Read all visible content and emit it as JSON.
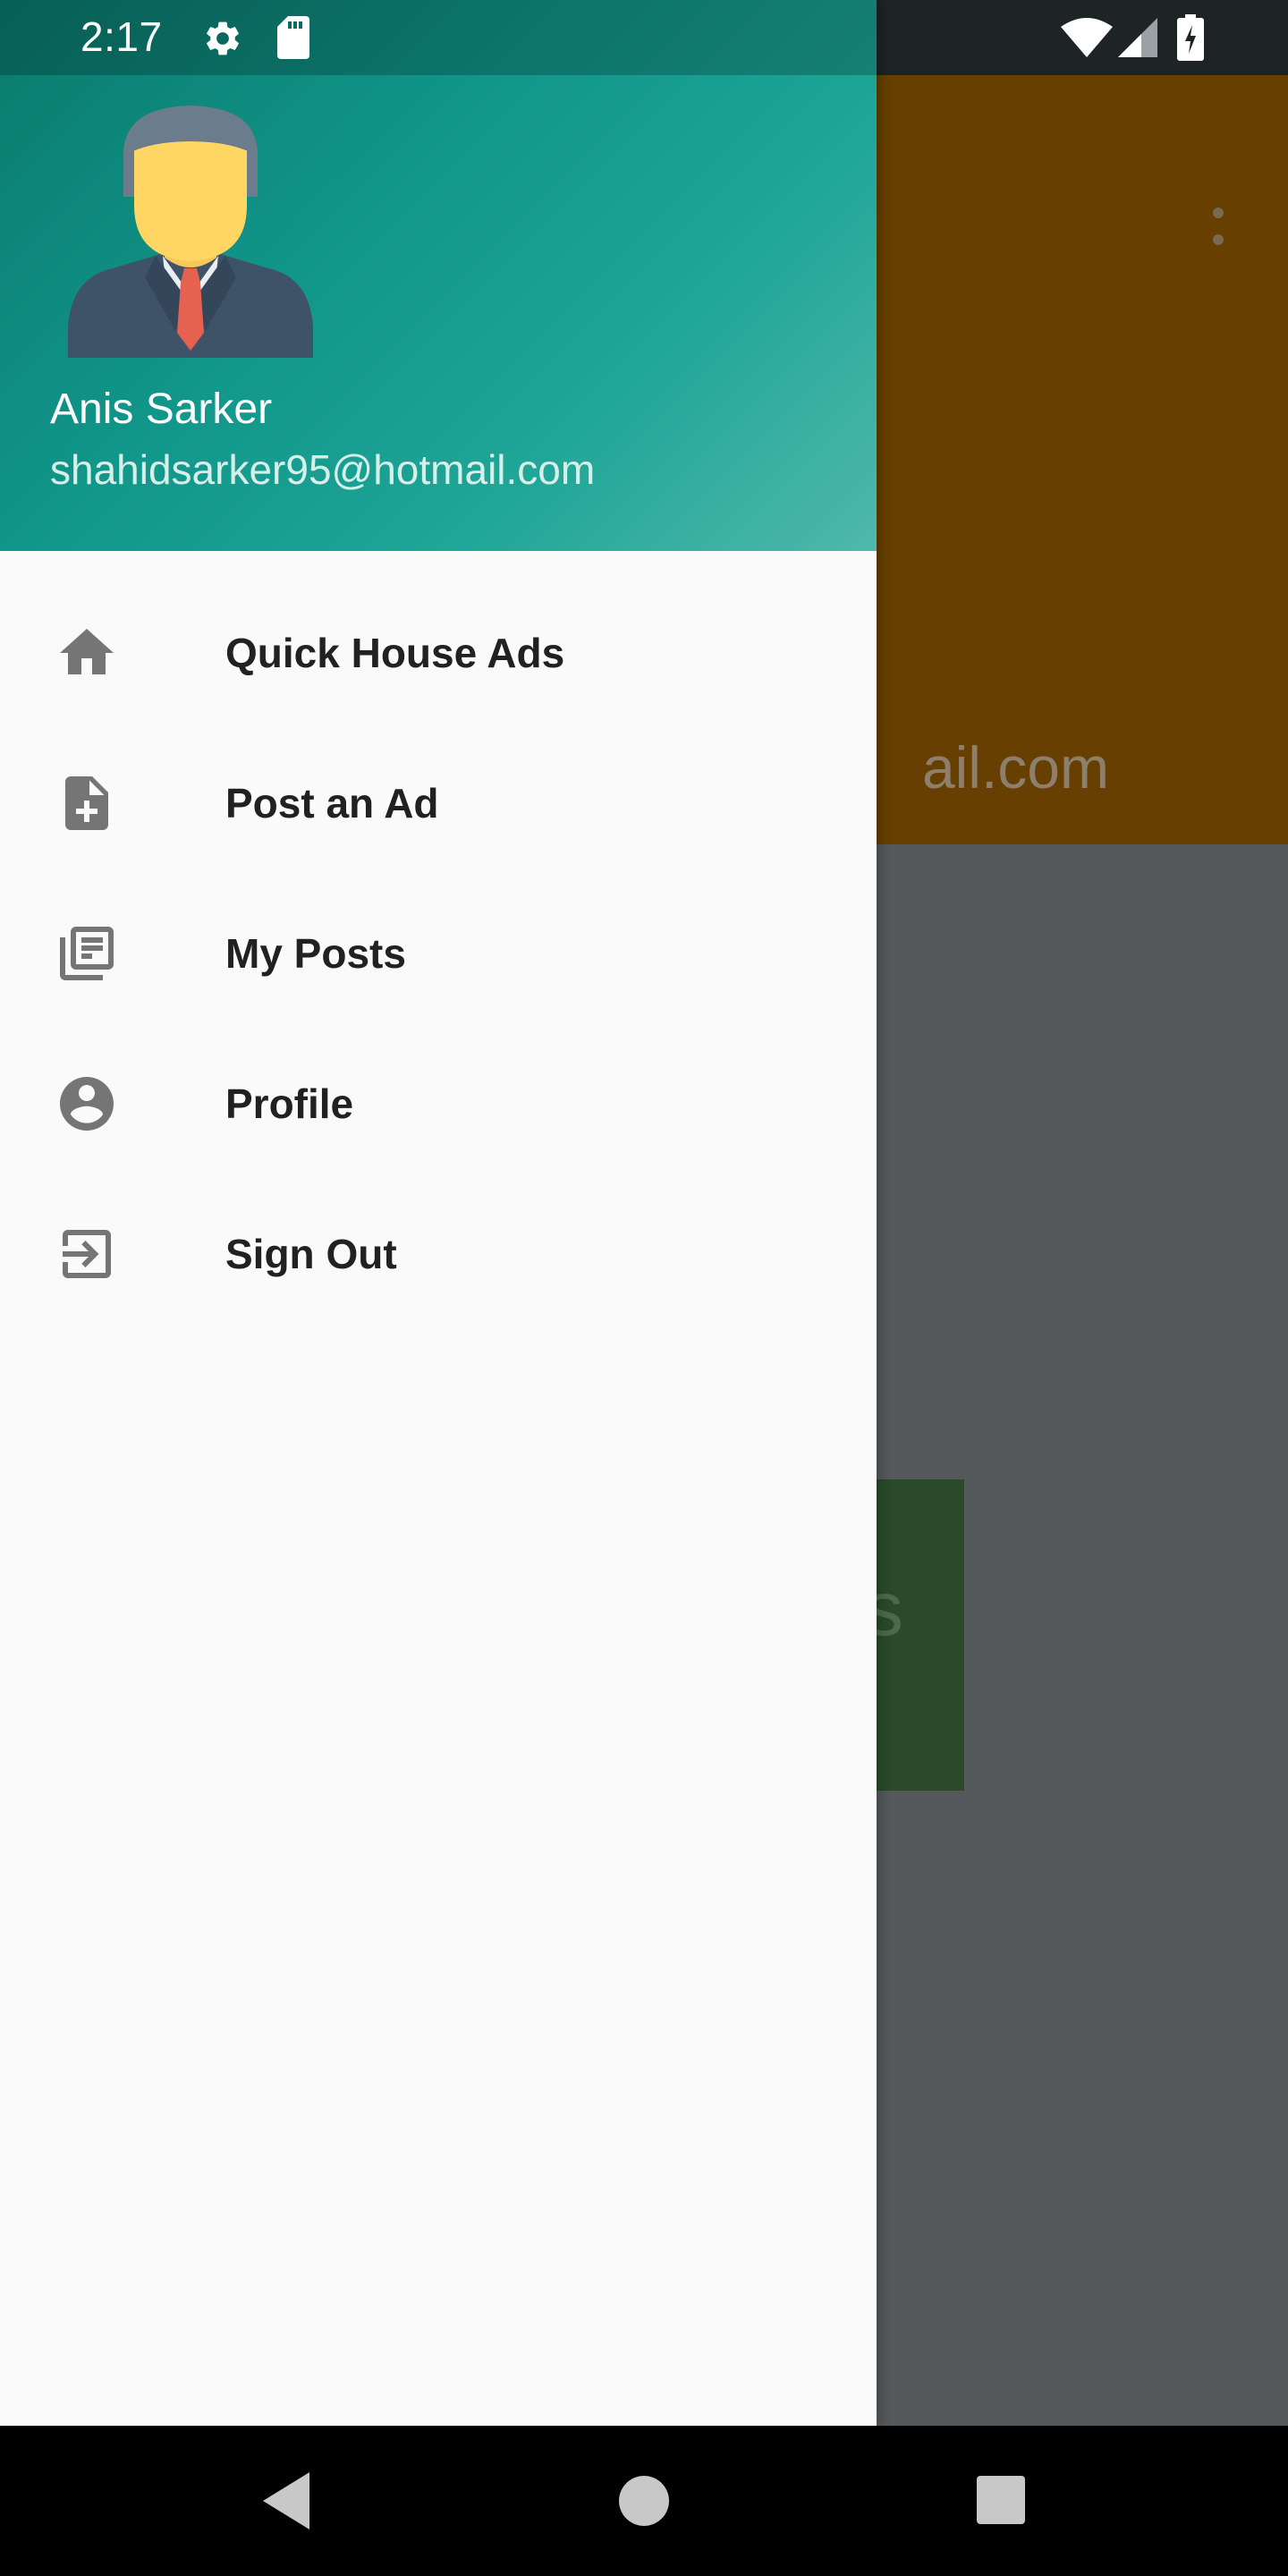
{
  "status_bar": {
    "time": "2:17",
    "icons": [
      "gear-icon",
      "sd-card-icon",
      "wifi-icon",
      "signal-icon",
      "battery-charging-icon"
    ]
  },
  "background": {
    "email_fragment": "ail.com",
    "button_fragment": "s",
    "toolbar_color": "#663f01",
    "button_color": "#2a4a29"
  },
  "drawer": {
    "header": {
      "name": "Anis Sarker",
      "email": "shahidsarker95@hotmail.com",
      "avatar_icon": "businessman-avatar-icon",
      "gradient_start": "#0a7a6d",
      "gradient_end": "#4fb8ac"
    },
    "items": [
      {
        "label": "Quick House Ads",
        "icon": "home-icon"
      },
      {
        "label": "Post an Ad",
        "icon": "note-add-icon"
      },
      {
        "label": "My Posts",
        "icon": "library-books-icon"
      },
      {
        "label": "Profile",
        "icon": "account-circle-icon"
      },
      {
        "label": "Sign Out",
        "icon": "sign-out-icon"
      }
    ]
  },
  "nav_bar": {
    "buttons": [
      "back-icon",
      "home-circle-icon",
      "recents-square-icon"
    ]
  }
}
